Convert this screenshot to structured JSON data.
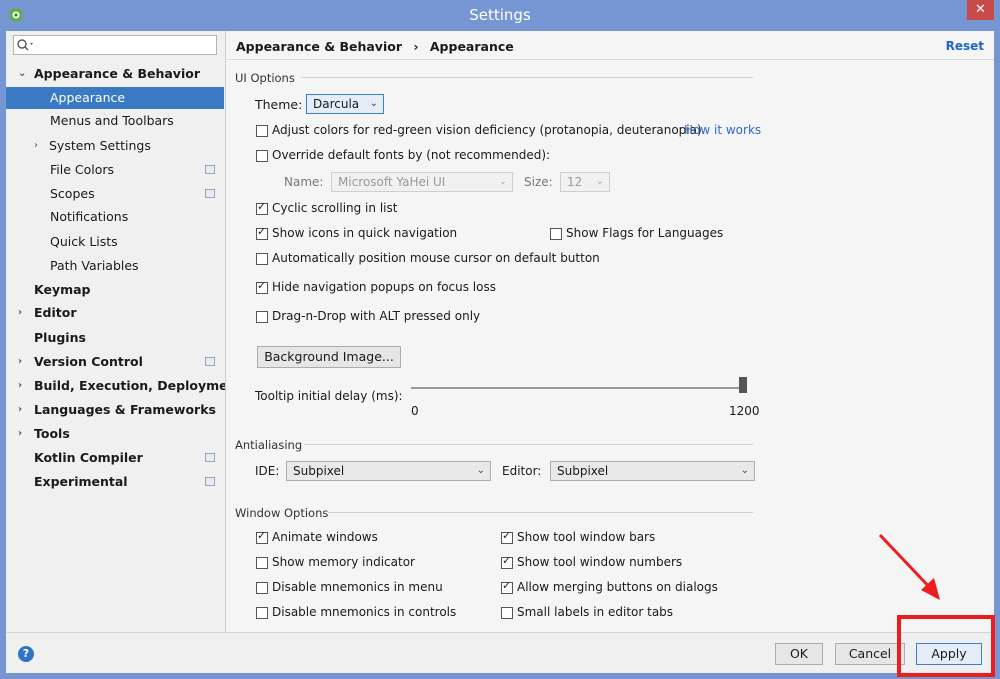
{
  "window": {
    "title": "Settings",
    "close_glyph": "✕"
  },
  "sidebar": {
    "search_placeholder": "",
    "items": [
      {
        "label": "Appearance & Behavior"
      },
      {
        "label": "Appearance"
      },
      {
        "label": "Menus and Toolbars"
      },
      {
        "label": "System Settings"
      },
      {
        "label": "File Colors"
      },
      {
        "label": "Scopes"
      },
      {
        "label": "Notifications"
      },
      {
        "label": "Quick Lists"
      },
      {
        "label": "Path Variables"
      },
      {
        "label": "Keymap"
      },
      {
        "label": "Editor"
      },
      {
        "label": "Plugins"
      },
      {
        "label": "Version Control"
      },
      {
        "label": "Build, Execution, Deployment"
      },
      {
        "label": "Languages & Frameworks"
      },
      {
        "label": "Tools"
      },
      {
        "label": "Kotlin Compiler"
      },
      {
        "label": "Experimental"
      }
    ]
  },
  "header": {
    "crumb_parent": "Appearance & Behavior",
    "crumb_sep": "›",
    "crumb_current": "Appearance",
    "reset": "Reset"
  },
  "ui_options": {
    "title": "UI Options",
    "theme_label": "Theme:",
    "theme_value": "Darcula",
    "adjust_colors": "Adjust colors for red-green vision deficiency (protanopia, deuteranopia)",
    "how_it_works": "How it works",
    "override_fonts": "Override default fonts by (not recommended):",
    "name_label": "Name:",
    "name_value": "Microsoft YaHei UI",
    "size_label": "Size:",
    "size_value": "12",
    "cyclic_scrolling": "Cyclic scrolling in list",
    "show_icons": "Show icons in quick navigation",
    "show_flags": "Show Flags for Languages",
    "auto_position": "Automatically position mouse cursor on default button",
    "hide_popups": "Hide navigation popups on focus loss",
    "drag_drop": "Drag-n-Drop with ALT pressed only",
    "background_image": "Background Image...",
    "tooltip_label": "Tooltip initial delay (ms):",
    "tooltip_min": "0",
    "tooltip_max": "1200",
    "tooltip_value_fraction": 1.0
  },
  "antialiasing": {
    "title": "Antialiasing",
    "ide_label": "IDE:",
    "ide_value": "Subpixel",
    "editor_label": "Editor:",
    "editor_value": "Subpixel"
  },
  "window_options": {
    "title": "Window Options",
    "animate_windows": "Animate windows",
    "show_memory": "Show memory indicator",
    "disable_mnemonics_menu": "Disable mnemonics in menu",
    "disable_mnemonics_controls": "Disable mnemonics in controls",
    "show_tool_bars": "Show tool window bars",
    "show_tool_numbers": "Show tool window numbers",
    "allow_merging": "Allow merging buttons on dialogs",
    "small_labels": "Small labels in editor tabs"
  },
  "footer": {
    "help": "?",
    "ok": "OK",
    "cancel": "Cancel",
    "apply": "Apply"
  },
  "colors": {
    "selection": "#3a79c4",
    "link": "#2a6bc7",
    "title_bar": "#7596d2",
    "annotation": "#ee1c1c"
  }
}
